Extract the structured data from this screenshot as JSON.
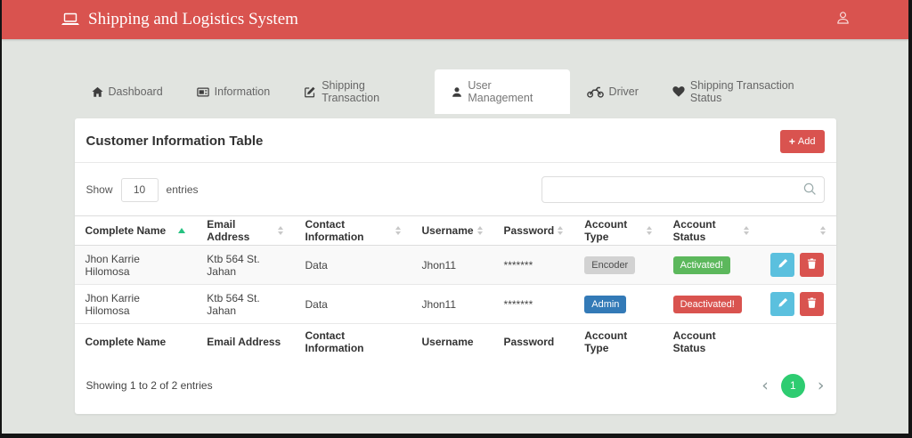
{
  "header": {
    "title": "Shipping and Logistics System"
  },
  "nav": {
    "tabs": [
      {
        "label": "Dashboard",
        "icon": "home-icon",
        "active": false
      },
      {
        "label": "Information",
        "icon": "newspaper-icon",
        "active": false
      },
      {
        "label": "Shipping Transaction",
        "icon": "edit-square-icon",
        "active": false
      },
      {
        "label": "User Management",
        "icon": "user-icon",
        "active": true
      },
      {
        "label": "Driver",
        "icon": "motorcycle-icon",
        "active": false
      },
      {
        "label": "Shipping Transaction Status",
        "icon": "heart-icon",
        "active": false
      }
    ]
  },
  "panel": {
    "title": "Customer Information Table",
    "add_button_label": "Add",
    "add_button_plus": "+",
    "length_control": {
      "show_label": "Show",
      "selected_value": "10",
      "entries_label": "entries"
    },
    "search": {
      "value": "",
      "placeholder": ""
    },
    "table": {
      "columns": [
        "Complete Name",
        "Email Address",
        "Contact Information",
        "Username",
        "Password",
        "Account Type",
        "Account Status",
        ""
      ],
      "sorted_column": "Complete Name",
      "sort_direction": "asc",
      "rows": [
        {
          "complete_name": "Jhon Karrie Hilomosa",
          "email_address": "Ktb 564 St. Jahan",
          "contact_information": "Data",
          "username": "Jhon11",
          "password": "*******",
          "account_type": "Encoder",
          "account_status": "Activated!"
        },
        {
          "complete_name": "Jhon Karrie Hilomosa",
          "email_address": "Ktb 564 St. Jahan",
          "contact_information": "Data",
          "username": "Jhon11",
          "password": "*******",
          "account_type": "Admin",
          "account_status": "Deactivated!"
        }
      ]
    },
    "summary": "Showing 1 to 2 of 2 entries",
    "pagination": {
      "prev": "‹",
      "current_page": "1",
      "next": "›"
    }
  },
  "colors": {
    "header_bg": "#d9534f",
    "page_bg": "#e1e4e0",
    "add_button": "#d9534f",
    "edit_button": "#5bc0de",
    "delete_button": "#d9534f",
    "badge_encoder": "#d2d2d2",
    "badge_admin": "#337ab7",
    "badge_activated": "#5cb85c",
    "badge_deactivated": "#d9534f",
    "pagination_active": "#2ecc71",
    "sort_active_arrow": "#26c281"
  }
}
